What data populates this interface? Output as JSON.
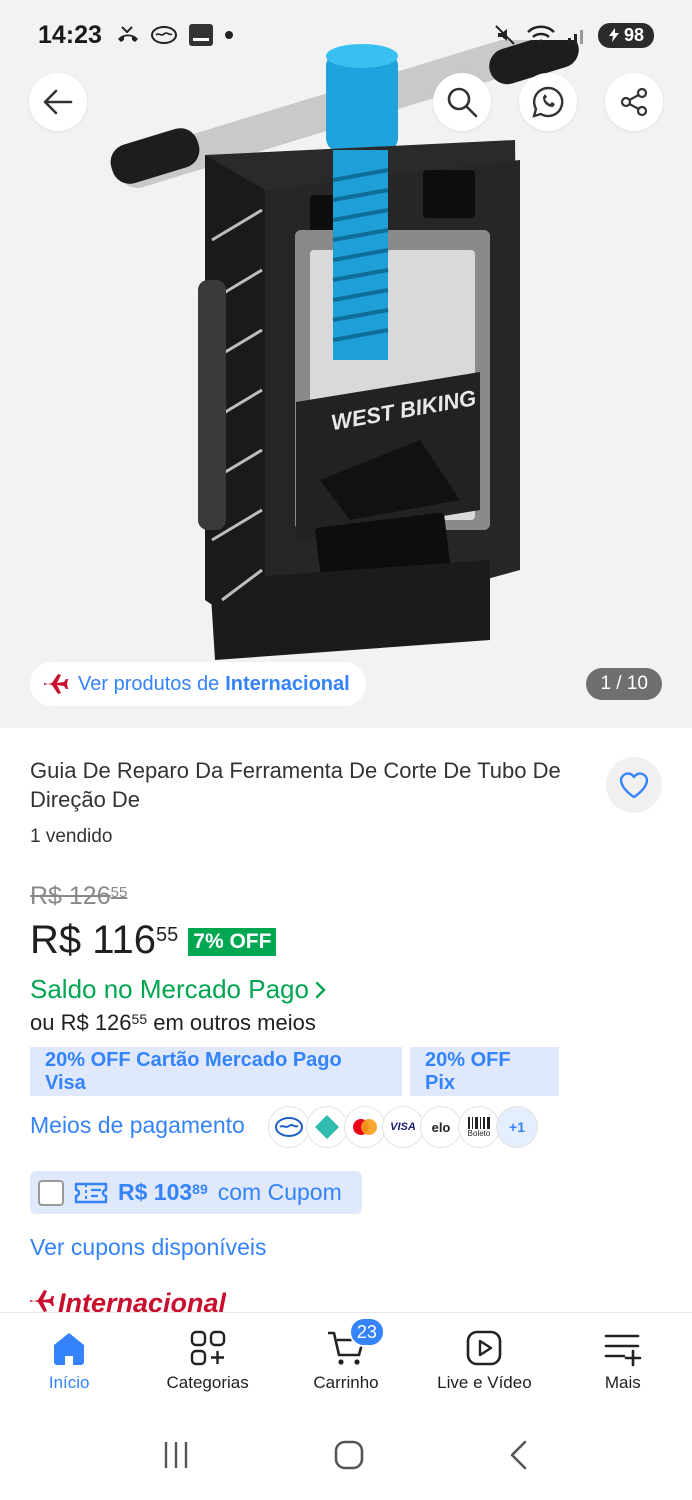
{
  "status_bar": {
    "time": "14:23",
    "battery": "98"
  },
  "hero": {
    "brand_text": "WEST BIKING",
    "intl_chip": {
      "prefix": "Ver produtos de",
      "highlight": "Internacional"
    },
    "counter": "1 / 10"
  },
  "product": {
    "title": "Guia De Reparo Da Ferramenta De Corte De Tubo De Direção De",
    "sold": "1 vendido",
    "old_price_int": "R$ 126",
    "old_price_cents": "55",
    "price_int": "R$ 116",
    "price_cents": "55",
    "discount": "7% OFF",
    "saldo_text": "Saldo no Mercado Pago",
    "outros_prefix": "ou R$ 126",
    "outros_cents": "55",
    "outros_suffix": "em outros meios"
  },
  "promos": [
    {
      "label": "20% OFF Cartão Mercado Pago Visa"
    },
    {
      "label": "20% OFF Pix"
    }
  ],
  "payment": {
    "label": "Meios de pagamento",
    "icons": [
      "mercado-pago-icon",
      "pix-icon",
      "mastercard-icon",
      "visa-icon",
      "elo-icon",
      "boleto-icon"
    ],
    "visa_text": "VISA",
    "elo_text": "elo",
    "boleto_text": "Boleto",
    "more": "+1"
  },
  "coupon": {
    "price_int": "R$ 103",
    "price_cents": "89",
    "suffix": "com Cupom"
  },
  "ver_cupons": "Ver cupons disponíveis",
  "intl_label": "Internacional",
  "bottom_nav": {
    "items": [
      {
        "label": "Início",
        "icon": "home-icon"
      },
      {
        "label": "Categorias",
        "icon": "categories-icon"
      },
      {
        "label": "Carrinho",
        "icon": "cart-icon"
      },
      {
        "label": "Live e Vídeo",
        "icon": "play-icon"
      },
      {
        "label": "Mais",
        "icon": "menu-plus-icon"
      }
    ],
    "cart_count": "23"
  },
  "colors": {
    "accent": "#3483fa",
    "green": "#00a650",
    "promo_bg": "#dfe9fb",
    "intl_red": "#c8102e"
  }
}
